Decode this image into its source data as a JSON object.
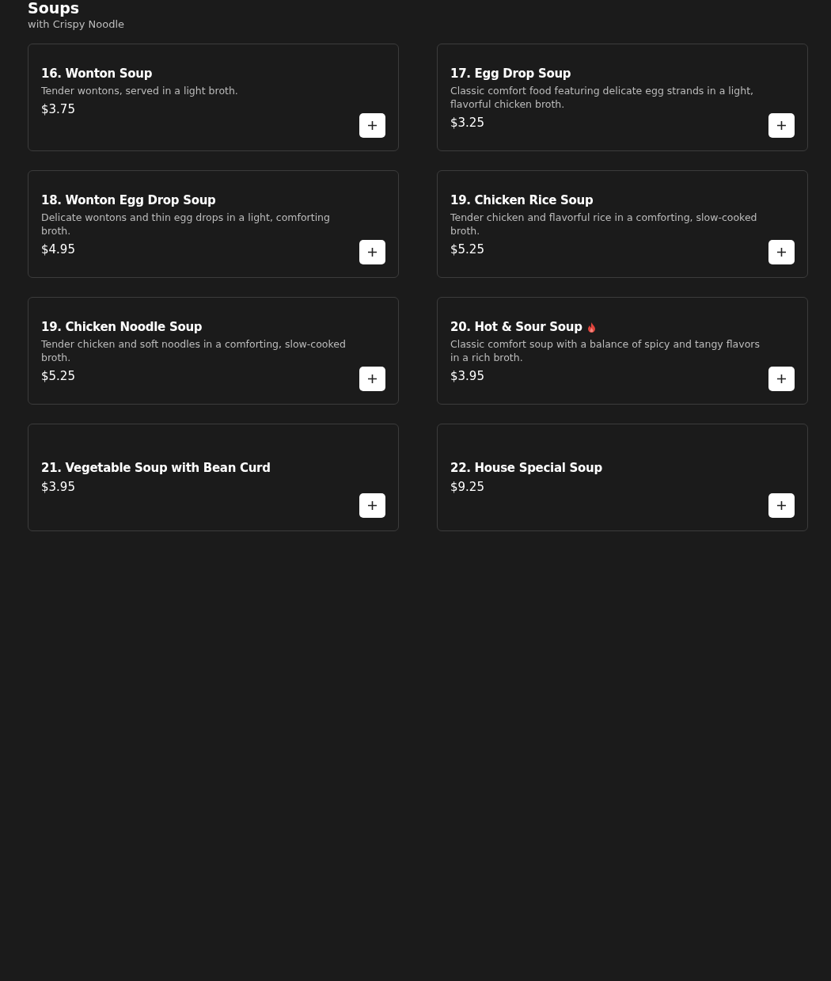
{
  "section": {
    "title": "Soups",
    "subtitle": "with Crispy Noodle"
  },
  "items": [
    {
      "name": "16. Wonton Soup",
      "description": "Tender wontons, served in a light broth.",
      "price": "$3.75",
      "spicy": false
    },
    {
      "name": "17. Egg Drop Soup",
      "description": "Classic comfort food featuring delicate egg strands in a light, flavorful chicken broth.",
      "price": "$3.25",
      "spicy": false
    },
    {
      "name": "18. Wonton Egg Drop Soup",
      "description": "Delicate wontons and thin egg drops in a light, comforting broth.",
      "price": "$4.95",
      "spicy": false
    },
    {
      "name": "19. Chicken Rice Soup",
      "description": "Tender chicken and flavorful rice in a comforting, slow-cooked broth.",
      "price": "$5.25",
      "spicy": false
    },
    {
      "name": "19. Chicken Noodle Soup",
      "description": "Tender chicken and soft noodles in a comforting, slow-cooked broth.",
      "price": "$5.25",
      "spicy": false
    },
    {
      "name": "20. Hot & Sour Soup",
      "description": "Classic comfort soup with a balance of spicy and tangy flavors in a rich broth.",
      "price": "$3.95",
      "spicy": true
    },
    {
      "name": "21. Vegetable Soup with Bean Curd",
      "price": "$3.95",
      "spicy": false
    },
    {
      "name": "22. House Special Soup",
      "price": "$9.25",
      "spicy": false
    }
  ]
}
